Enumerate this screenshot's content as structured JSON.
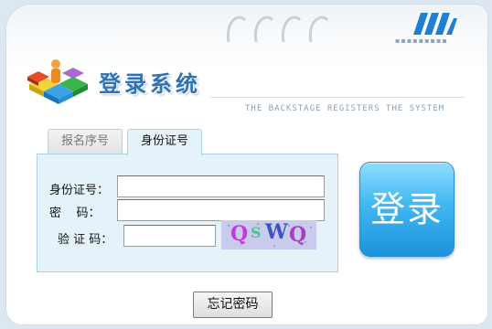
{
  "header": {
    "title": "登录系统",
    "subtitle": "THE BACKSTAGE REGISTERS THE SYSTEM",
    "logo_icon": "colorful-cubes-person-icon"
  },
  "tabs": [
    {
      "label": "报名序号",
      "active": false
    },
    {
      "label": "身份证号",
      "active": true
    }
  ],
  "form": {
    "id_label": "身份证号：",
    "password_label": "密    码：",
    "captcha_label": "验 证 码：",
    "id_value": "",
    "password_value": "",
    "captcha_value": "",
    "captcha_text": "QSWQ"
  },
  "buttons": {
    "login": "登录",
    "forget": "忘记密码"
  },
  "colors": {
    "title": "#2e74b2",
    "form_bg": "#e6f2f9",
    "login_top": "#8fdcff",
    "login_bottom": "#1c93dc"
  }
}
